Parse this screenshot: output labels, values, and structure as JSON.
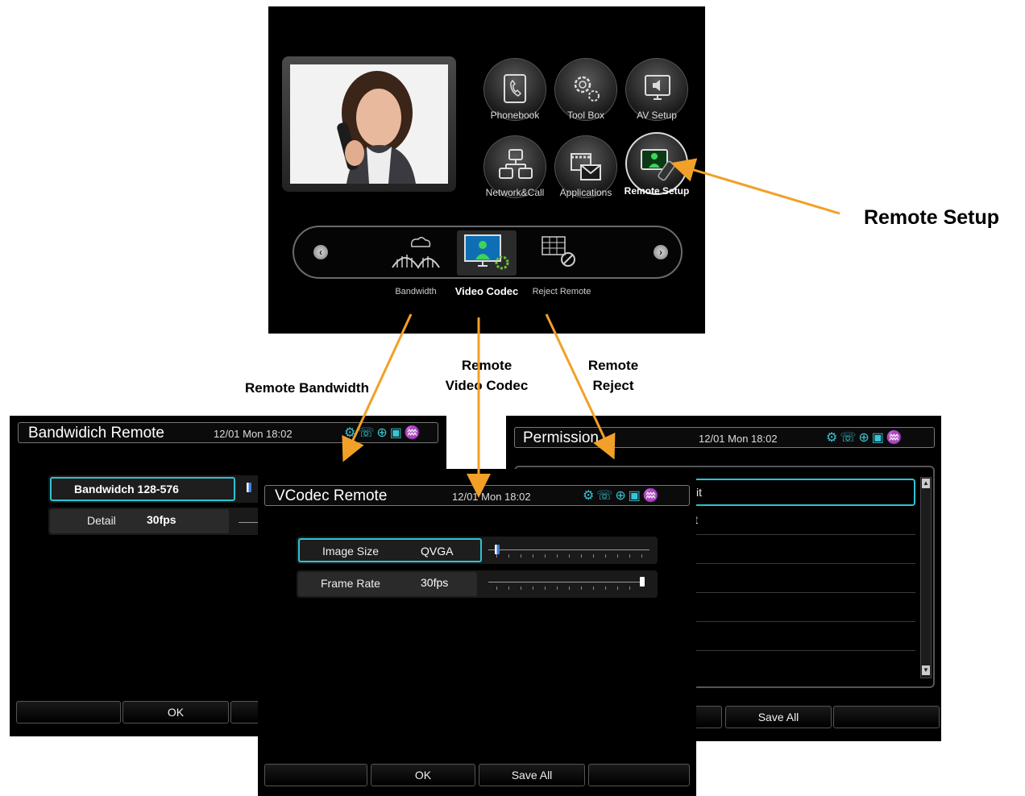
{
  "main_menu": {
    "items": [
      {
        "label": "Phonebook",
        "icon": "phonebook-icon"
      },
      {
        "label": "Tool Box",
        "icon": "toolbox-icon"
      },
      {
        "label": "AV Setup",
        "icon": "av-setup-icon"
      },
      {
        "label": "Network&Call",
        "icon": "network-call-icon"
      },
      {
        "label": "Applications",
        "icon": "applications-icon"
      },
      {
        "label": "Remote Setup",
        "icon": "remote-setup-icon",
        "selected": true
      }
    ],
    "submenu": [
      {
        "label": "Bandwidth",
        "icon": "bandwidth-icon"
      },
      {
        "label": "Video Codec",
        "icon": "video-codec-icon",
        "selected": true
      },
      {
        "label": "Reject Remote",
        "icon": "reject-remote-icon"
      }
    ]
  },
  "callouts": {
    "remote_setup": "Remote Setup",
    "remote_bandwidth": "Remote Bandwidth",
    "remote_video_codec_1": "Remote",
    "remote_video_codec_2": "Video Codec",
    "remote_reject_1": "Remote",
    "remote_reject_2": "Reject"
  },
  "bandwidth_panel": {
    "title": "Bandwidich Remote",
    "time": "12/01 Mon 18:02",
    "field1": "Bandwidch 128-576",
    "field2_label": "Detail",
    "field2_value": "30fps",
    "footer": [
      "",
      "OK",
      ""
    ]
  },
  "permission_panel": {
    "title": "Permission",
    "time": "12/01 Mon 18:02",
    "rows": [
      "it",
      "t",
      "",
      "",
      "",
      "",
      ""
    ],
    "footer": [
      "",
      "Save All",
      ""
    ]
  },
  "vcodec_panel": {
    "title": "VCodec Remote",
    "time": "12/01 Mon 18:02",
    "image_size_label": "Image Size",
    "image_size_value": "QVGA",
    "frame_rate_label": "Frame Rate",
    "frame_rate_value": "30fps",
    "image_size_level": 0.0,
    "frame_rate_level": 1.0,
    "footer": [
      "",
      "OK",
      "Save All",
      ""
    ]
  },
  "status_icons": [
    "gear-icon",
    "handset-icon",
    "globe-icon",
    "calendar-icon",
    "network-icon"
  ],
  "colors": {
    "accent": "#2ec3d1",
    "arrow": "#f2a027",
    "panel_bg": "#000000"
  }
}
